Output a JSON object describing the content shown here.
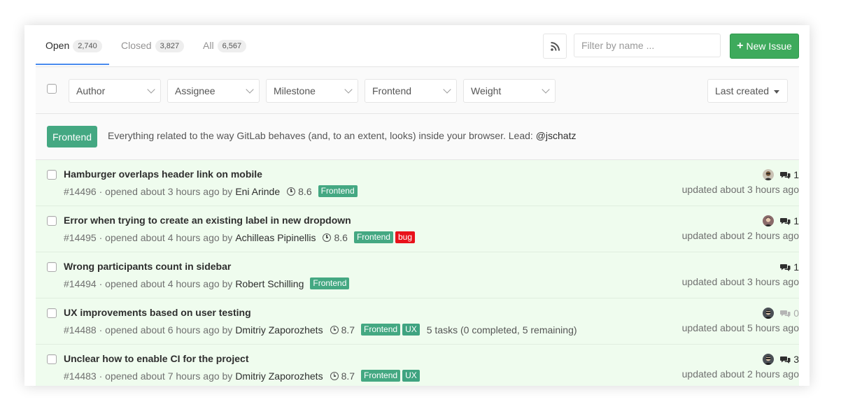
{
  "tabs": [
    {
      "label": "Open",
      "count": "2,740"
    },
    {
      "label": "Closed",
      "count": "3,827"
    },
    {
      "label": "All",
      "count": "6,567"
    }
  ],
  "filter_input": {
    "placeholder": "Filter by name ..."
  },
  "new_issue_label": "New Issue",
  "filters": {
    "author": "Author",
    "assignee": "Assignee",
    "milestone": "Milestone",
    "label": "Frontend",
    "weight": "Weight"
  },
  "sort_label": "Last created",
  "label_description": {
    "label": "Frontend",
    "text": "Everything related to the way GitLab behaves (and, to an extent, looks) inside your browser. Lead:",
    "lead": "@jschatz",
    "color": "#44a882"
  },
  "colors": {
    "accent_blue": "#4a8bee",
    "new_issue_green": "#3eaa5c",
    "label_frontend": "#44a882",
    "label_bug": "#e8111a",
    "label_ux": "#3fa380",
    "row_bg": "#effcee"
  },
  "issues": [
    {
      "title": "Hamburger overlaps header link on mobile",
      "ref": "#14496",
      "opened": "· opened about 3 hours ago by",
      "author": "Eni Arinde",
      "milestone": "8.6",
      "labels": [
        "Frontend"
      ],
      "tasks": "",
      "comments": "1",
      "updated": "updated about 3 hours ago"
    },
    {
      "title": "Error when trying to create an existing label in new dropdown",
      "ref": "#14495",
      "opened": "· opened about 4 hours ago by",
      "author": "Achilleas Pipinellis",
      "milestone": "8.6",
      "labels": [
        "Frontend",
        "bug"
      ],
      "tasks": "",
      "comments": "1",
      "updated": "updated about 2 hours ago"
    },
    {
      "title": "Wrong participants count in sidebar",
      "ref": "#14494",
      "opened": "· opened about 4 hours ago by",
      "author": "Robert Schilling",
      "milestone": "",
      "labels": [
        "Frontend"
      ],
      "tasks": "",
      "comments": "1",
      "updated": "updated about 3 hours ago"
    },
    {
      "title": "UX improvements based on user testing",
      "ref": "#14488",
      "opened": "· opened about 6 hours ago by",
      "author": "Dmitriy Zaporozhets",
      "milestone": "8.7",
      "labels": [
        "Frontend",
        "UX"
      ],
      "tasks": "5 tasks (0 completed, 5 remaining)",
      "comments": "0",
      "updated": "updated about 5 hours ago"
    },
    {
      "title": "Unclear how to enable CI for the project",
      "ref": "#14483",
      "opened": "· opened about 7 hours ago by",
      "author": "Dmitriy Zaporozhets",
      "milestone": "8.7",
      "labels": [
        "Frontend",
        "UX"
      ],
      "tasks": "",
      "comments": "3",
      "updated": "updated about 2 hours ago"
    }
  ]
}
